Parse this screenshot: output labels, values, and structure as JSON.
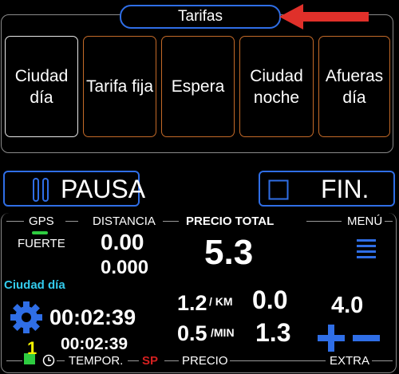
{
  "tariffs": {
    "title": "Tarifas",
    "items": [
      {
        "label": "Ciudad\ndía",
        "selected": true
      },
      {
        "label": "Tarifa fija",
        "selected": false
      },
      {
        "label": "Espera",
        "selected": false
      },
      {
        "label": "Ciudad\nnoche",
        "selected": false
      },
      {
        "label": "Afueras\ndía",
        "selected": false
      }
    ]
  },
  "controls": {
    "pause_label": "PAUSA",
    "finish_label": "FIN."
  },
  "meter": {
    "gps_label": "GPS",
    "gps_signal": "FUERTE",
    "distance_label": "DISTANCIA",
    "distance_main": "0.00",
    "distance_sub": "0.000",
    "total_label": "PRECIO TOTAL",
    "total_value": "5.3",
    "menu_label": "MENÚ",
    "tariff_name": "Ciudad día",
    "time_main": "00:02:39",
    "time_sub": "00:02:39",
    "rate_km": "1.2",
    "rate_km_unit": "/ KM",
    "rate_min": "0.5",
    "rate_min_unit": "/MIN",
    "price_km": "0.0",
    "price_min": "1.3",
    "extra_value": "4.0",
    "plus": "+",
    "minus": "−",
    "timer_label": "TEMPOR.",
    "sp_label": "SP",
    "price_label": "PRECIO",
    "extra_label": "EXTRA",
    "badge_number": "1"
  },
  "colors": {
    "accent_blue": "#2f6ee6",
    "tariff_border": "#c46a28",
    "gps_green": "#2ecc40",
    "tariff_name_cyan": "#33ccee",
    "sp_red": "#d42020",
    "arrow_red": "#e0302a",
    "badge_yellow": "#f2f200"
  }
}
